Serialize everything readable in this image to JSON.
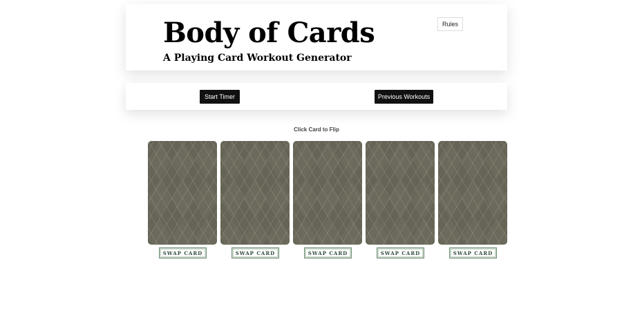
{
  "header": {
    "title": "Body of Cards",
    "subtitle": "A Playing Card Workout Generator",
    "rules_label": "Rules"
  },
  "controls": {
    "start_timer_label": "Start Timer",
    "previous_workouts_label": "Previous Workouts"
  },
  "instruction": "Click Card to Flip",
  "cards": [
    {
      "swap_label": "SWAP CARD"
    },
    {
      "swap_label": "SWAP CARD"
    },
    {
      "swap_label": "SWAP CARD"
    },
    {
      "swap_label": "SWAP CARD"
    },
    {
      "swap_label": "SWAP CARD"
    }
  ],
  "colors": {
    "card_back": "#6c6a5c",
    "button_dark": "#111111",
    "swap_text": "#2f4a3a"
  }
}
